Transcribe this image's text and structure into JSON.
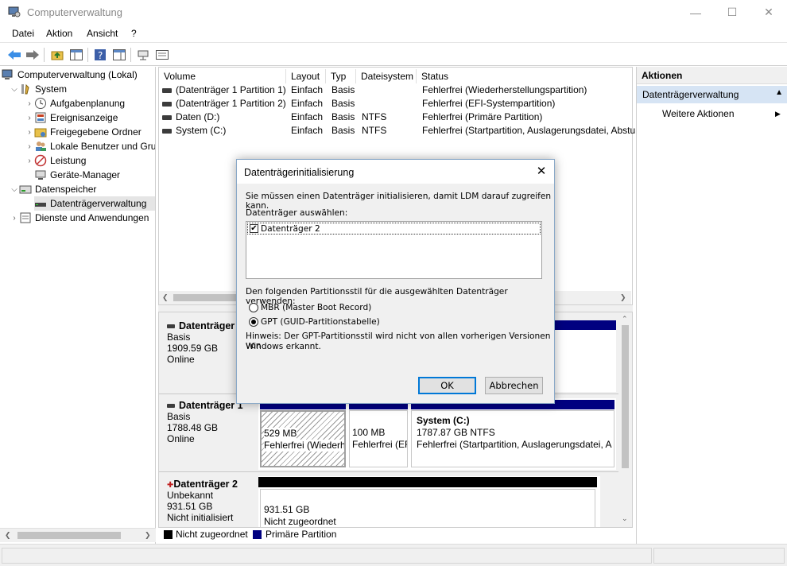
{
  "window": {
    "title": "Computerverwaltung",
    "minimize": "—",
    "maximize": "☐",
    "close": "✕"
  },
  "menu": [
    "Datei",
    "Aktion",
    "Ansicht",
    "?"
  ],
  "tree": {
    "root": "Computerverwaltung (Lokal)",
    "system": "System",
    "items": [
      "Aufgabenplanung",
      "Ereignisanzeige",
      "Freigegebene Ordner",
      "Lokale Benutzer und Gruppen",
      "Leistung",
      "Geräte-Manager"
    ],
    "storage": "Datenspeicher",
    "disk_mgmt": "Datenträgerverwaltung",
    "services": "Dienste und Anwendungen"
  },
  "list": {
    "columns": [
      "Volume",
      "Layout",
      "Typ",
      "Dateisystem",
      "Status"
    ],
    "rows": [
      [
        "(Datenträger 1 Partition 1)",
        "Einfach",
        "Basis",
        "",
        "Fehlerfrei (Wiederherstellungspartition)"
      ],
      [
        "(Datenträger 1 Partition 2)",
        "Einfach",
        "Basis",
        "",
        "Fehlerfrei (EFI-Systempartition)"
      ],
      [
        "Daten (D:)",
        "Einfach",
        "Basis",
        "NTFS",
        "Fehlerfrei (Primäre Partition)"
      ],
      [
        "System (C:)",
        "Einfach",
        "Basis",
        "NTFS",
        "Fehlerfrei (Startpartition, Auslagerungsdatei, Abstu"
      ]
    ]
  },
  "disks": {
    "d0": {
      "name": "Datenträger 0",
      "type": "Basis",
      "size": "1909.59 GB",
      "state": "Online"
    },
    "d1": {
      "name": "Datenträger 1",
      "type": "Basis",
      "size": "1788.48 GB",
      "state": "Online",
      "p1_size": "529 MB",
      "p1_status": "Fehlerfrei (Wiederh",
      "p2_size": "100 MB",
      "p2_status": "Fehlerfrei (EF",
      "p3_name": "System  (C:)",
      "p3_size": "1787.87 GB NTFS",
      "p3_status": "Fehlerfrei (Startpartition, Auslagerungsdatei, A"
    },
    "d2": {
      "name": "Datenträger 2",
      "type": "Unbekannt",
      "size": "931.51 GB",
      "state": "Nicht initialisiert",
      "p_size": "931.51 GB",
      "p_status": "Nicht zugeordnet"
    }
  },
  "legend": {
    "unallocated": "Nicht zugeordnet",
    "primary": "Primäre Partition"
  },
  "actions": {
    "header": "Aktionen",
    "group": "Datenträgerverwaltung",
    "more": "Weitere Aktionen"
  },
  "dialog": {
    "title": "Datenträgerinitialisierung",
    "intro": "Sie müssen einen Datenträger initialisieren, damit LDM darauf zugreifen kann.",
    "select_label": "Datenträger auswählen:",
    "disk_item": "Datenträger 2",
    "style_label": "Den folgenden Partitionsstil für die ausgewählten Datenträger verwenden:",
    "mbr": "MBR (Master Boot Record)",
    "gpt": "GPT (GUID-Partitionstabelle)",
    "hint_line1": "Hinweis: Der GPT-Partitionsstil wird nicht von allen vorherigen Versionen von",
    "hint_line2": "Windows erkannt.",
    "ok": "OK",
    "cancel": "Abbrechen"
  },
  "colors": {
    "primary_partition": "#000080",
    "unallocated": "#000000",
    "selection": "#d6e4f4",
    "accent": "#0078d7"
  }
}
